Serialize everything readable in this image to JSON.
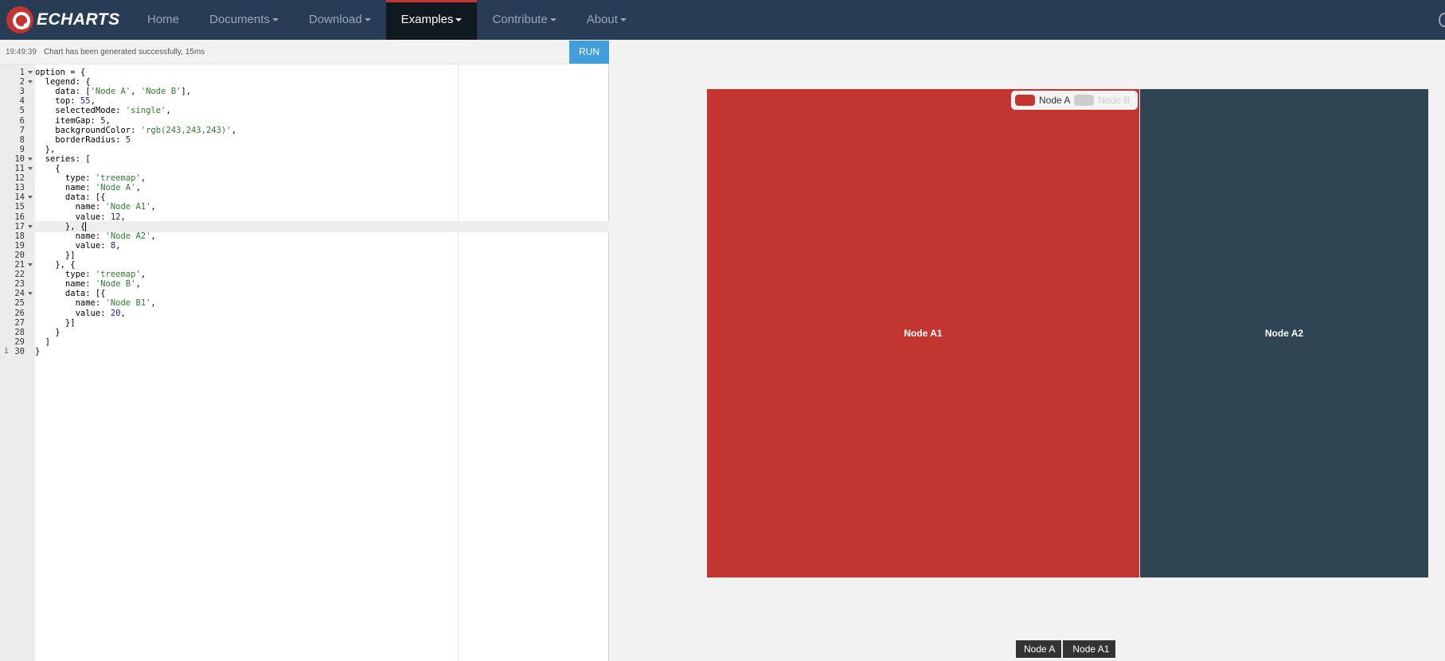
{
  "nav": {
    "brand": "ECHARTS",
    "items": [
      {
        "label": "Home",
        "dropdown": false
      },
      {
        "label": "Documents",
        "dropdown": true
      },
      {
        "label": "Download",
        "dropdown": true
      },
      {
        "label": "Examples",
        "dropdown": true,
        "active": true
      },
      {
        "label": "Contribute",
        "dropdown": true
      },
      {
        "label": "About",
        "dropdown": true
      }
    ]
  },
  "editor": {
    "status_time": "19:49:39",
    "status_message": "Chart has been generated successfully, 15ms",
    "run_label": "RUN",
    "active_line": 17,
    "info_line": 30,
    "fold_lines": [
      1,
      2,
      10,
      11,
      14,
      17,
      21,
      24
    ],
    "code_lines": [
      "option = {",
      "  legend: {",
      "    data: ['Node A', 'Node B'],",
      "    top: 55,",
      "    selectedMode: 'single',",
      "    itemGap: 5,",
      "    backgroundColor: 'rgb(243,243,243)',",
      "    borderRadius: 5",
      "  },",
      "  series: [",
      "    {",
      "      type: 'treemap',",
      "      name: 'Node A',",
      "      data: [{",
      "        name: 'Node A1',",
      "        value: 12,",
      "      }, {",
      "        name: 'Node A2',",
      "        value: 8,",
      "      }]",
      "    }, {",
      "      type: 'treemap',",
      "      name: 'Node B',",
      "      data: [{",
      "        name: 'Node B1',",
      "        value: 20,",
      "      }]",
      "    }",
      "  ]",
      "}"
    ]
  },
  "preview": {
    "legend": [
      {
        "label": "Node A",
        "color": "#c23531",
        "selected": true
      },
      {
        "label": "Node B",
        "color": "#cccccc",
        "selected": false
      }
    ],
    "treemap": [
      {
        "label": "Node A1",
        "value": 12,
        "color": "#c23531"
      },
      {
        "label": "Node A2",
        "value": 8,
        "color": "#2f4554"
      }
    ],
    "breadcrumb": [
      "Node A",
      "Node A1"
    ]
  }
}
